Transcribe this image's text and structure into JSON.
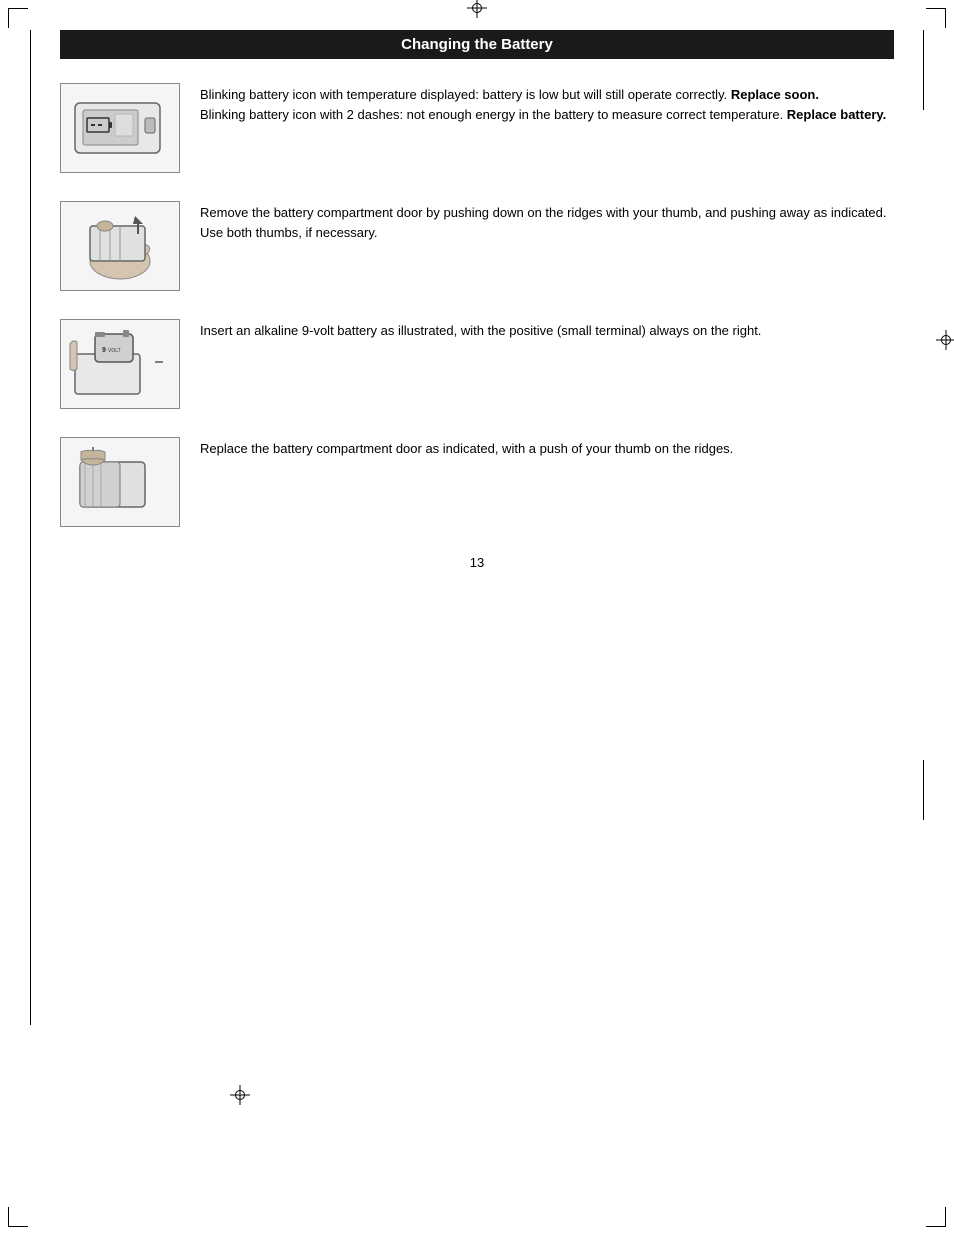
{
  "page": {
    "title": "Changing the Battery",
    "page_number": "13",
    "accent_color": "#1a1a1a",
    "bg_color": "#ffffff"
  },
  "instructions": [
    {
      "id": "step1",
      "text_parts": [
        {
          "text": "Blinking battery icon with temperature displayed: battery is low but will still operate correctly. ",
          "bold": false
        },
        {
          "text": "Replace soon.",
          "bold": true
        },
        {
          "text": "\nBlinking battery icon with 2 dashes: not enough energy in the battery to measure correct temperature. ",
          "bold": false
        },
        {
          "text": "Replace battery.",
          "bold": true
        }
      ],
      "image_alt": "battery indicator display showing low battery"
    },
    {
      "id": "step2",
      "text": "Remove the battery compartment door by pushing down on the ridges with your thumb, and pushing away as indicated. Use both thumbs, if necessary.",
      "image_alt": "hand removing battery compartment door"
    },
    {
      "id": "step3",
      "text": "Insert an alkaline 9-volt battery as illustrated, with the positive (small terminal) always on the right.",
      "image_alt": "inserting 9-volt battery"
    },
    {
      "id": "step4",
      "text": "Replace the battery compartment door as indicated, with a push of your thumb on the ridges.",
      "image_alt": "replacing battery compartment door"
    }
  ]
}
